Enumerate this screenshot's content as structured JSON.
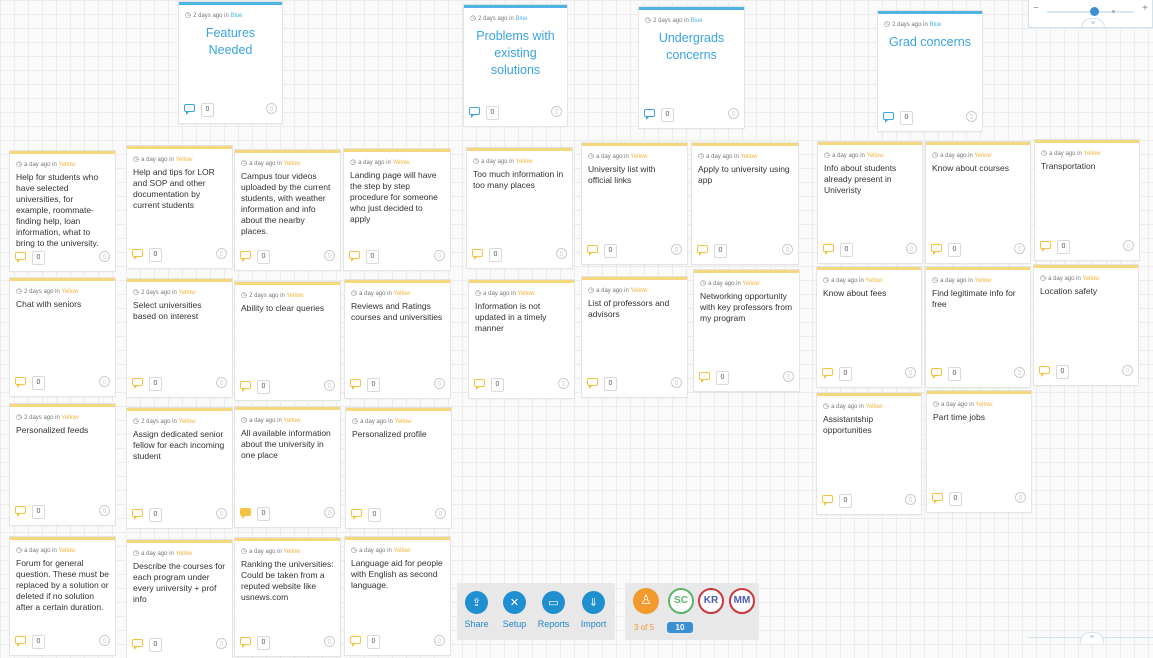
{
  "columns": [
    {
      "title": "Features Needed",
      "meta_time": "2 days ago in",
      "meta_color": "Blue",
      "comments": "0"
    },
    {
      "title": "Problems with existing solutions",
      "meta_time": "2 days ago in",
      "meta_color": "Blue",
      "comments": "0"
    },
    {
      "title": "Undergrads concerns",
      "meta_time": "2 days ago in",
      "meta_color": "Blue",
      "comments": "0"
    },
    {
      "title": "Grad concerns",
      "meta_time": "2 days ago in",
      "meta_color": "Blue",
      "comments": "0"
    }
  ],
  "notes": [
    {
      "text": "Help for students who have selected universities, for example, roommate-finding help, loan information, what to bring to the university.",
      "time": "a day ago in",
      "color": "Yellow",
      "comments": "0"
    },
    {
      "text": "Help and tips for LOR and SOP and other documentation by current students",
      "time": "a day ago in",
      "color": "Yellow",
      "comments": "0"
    },
    {
      "text": "Campus tour videos uploaded by the current students, with weather information and info about the nearby places.",
      "time": "a day ago in",
      "color": "Yellow",
      "comments": "0"
    },
    {
      "text": "Landing page will have the step by step procedure for someone who just decided to apply",
      "time": "a day ago in",
      "color": "Yellow",
      "comments": "0"
    },
    {
      "text": "Chat with seniors",
      "time": "2 days ago in",
      "color": "Yellow",
      "comments": "0"
    },
    {
      "text": "Select universities based on interest",
      "time": "2 days ago in",
      "color": "Yellow",
      "comments": "0"
    },
    {
      "text": "Ability to clear queries",
      "time": "2 days ago in",
      "color": "Yellow",
      "comments": "0"
    },
    {
      "text": "Reviews and Ratings courses and universities",
      "time": "a day ago in",
      "color": "Yellow",
      "comments": "0"
    },
    {
      "text": "Personalized feeds",
      "time": "2 days ago in",
      "color": "Yellow",
      "comments": "0"
    },
    {
      "text": "Assign dedicated senior fellow for each incoming student",
      "time": "2 days ago in",
      "color": "Yellow",
      "comments": "0"
    },
    {
      "text": "All available information about the university in one place",
      "time": "a day ago in",
      "color": "Yellow",
      "comments": "0"
    },
    {
      "text": "Personalized profile",
      "time": "a day ago in",
      "color": "Yellow",
      "comments": "0"
    },
    {
      "text": "Forum for general question. These must be replaced by a solution or deleted if no solution after a certain duration.",
      "time": "a day ago in",
      "color": "Yellow",
      "comments": "0"
    },
    {
      "text": "Describe the courses for each program under every university + prof info",
      "time": "a day ago in",
      "color": "Yellow",
      "comments": "0"
    },
    {
      "text": "Ranking the universities: Could be taken from a reputed website like usnews.com",
      "time": "a day ago in",
      "color": "Yellow",
      "comments": "0"
    },
    {
      "text": "Language aid for people with English as second language.",
      "time": "a day ago in",
      "color": "Yellow",
      "comments": "0"
    },
    {
      "text": "Too much information in too many places",
      "time": "a day ago in",
      "color": "Yellow",
      "comments": "0"
    },
    {
      "text": "Information is not updated in a timely manner",
      "time": "a day ago in",
      "color": "Yellow",
      "comments": "0"
    },
    {
      "text": "University list with official links",
      "time": "a day ago in",
      "color": "Yellow",
      "comments": "0"
    },
    {
      "text": "Apply to university using app",
      "time": "a day ago in",
      "color": "Yellow",
      "comments": "0"
    },
    {
      "text": "List of professors and advisors",
      "time": "a day ago in",
      "color": "Yellow",
      "comments": "0"
    },
    {
      "text": "Networking opportunity with key professors from my program",
      "time": "a day ago in",
      "color": "Yellow",
      "comments": "0"
    },
    {
      "text": "Info about students already present in Univeristy",
      "time": "a day ago in",
      "color": "Yellow",
      "comments": "0"
    },
    {
      "text": "Know about courses",
      "time": "a day ago in",
      "color": "Yellow",
      "comments": "0"
    },
    {
      "text": "Transportation",
      "time": "a day ago in",
      "color": "Yellow",
      "comments": "0"
    },
    {
      "text": "Know about fees",
      "time": "a day ago in",
      "color": "Yellow",
      "comments": "0"
    },
    {
      "text": "Find legitimate info for free",
      "time": "a day ago in",
      "color": "Yellow",
      "comments": "0"
    },
    {
      "text": "Location safety",
      "time": "a day ago in",
      "color": "Yellow",
      "comments": "0"
    },
    {
      "text": "Assistantship opportunities",
      "time": "a day ago in",
      "color": "Yellow",
      "comments": "0"
    },
    {
      "text": "Part time jobs",
      "time": "a day ago in",
      "color": "Yellow",
      "comments": "0"
    }
  ],
  "zoom": {
    "minus": "−",
    "plus": "+",
    "menu_icon": "≡"
  },
  "toolbar": {
    "share": "Share",
    "setup": "Setup",
    "reports": "Reports",
    "import": "Import"
  },
  "users": {
    "count": "3 of 5",
    "online": "10",
    "avatars": [
      "SC",
      "KR",
      "MM"
    ]
  },
  "accent_colors": {
    "blue": "#4fb3e4",
    "yellow": "#f5d77e",
    "tool_blue": "#1f8fcf",
    "user_orange": "#f29a2e",
    "sc_green": "#5fb36a",
    "red": "#c8383c"
  }
}
